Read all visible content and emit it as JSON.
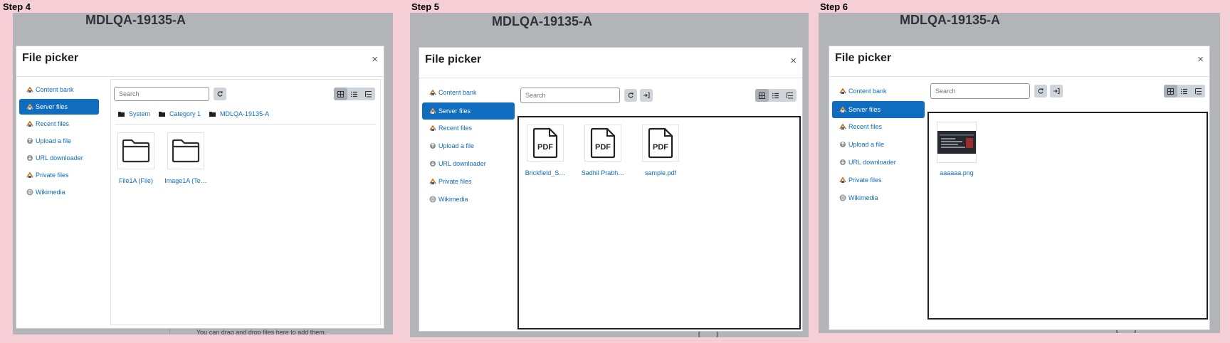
{
  "panels": [
    {
      "step": "Step 4",
      "course": "MDLQA-19135-A",
      "dialog": {
        "title": "File picker",
        "close": "×",
        "repos": [
          {
            "label": "Content bank",
            "icon": "content-bank-icon",
            "active": false
          },
          {
            "label": "Server files",
            "icon": "server-files-icon",
            "active": true
          },
          {
            "label": "Recent files",
            "icon": "recent-files-icon",
            "active": false
          },
          {
            "label": "Upload a file",
            "icon": "upload-icon",
            "active": false
          },
          {
            "label": "URL downloader",
            "icon": "url-downloader-icon",
            "active": false
          },
          {
            "label": "Private files",
            "icon": "private-files-icon",
            "active": false
          },
          {
            "label": "Wikimedia",
            "icon": "wikimedia-icon",
            "active": false
          }
        ],
        "search_placeholder": "Search",
        "breadcrumb": [
          "System",
          "Category 1",
          "MDLQA-19135-A"
        ],
        "files": [
          {
            "name": "File1A (File)",
            "kind": "folder"
          },
          {
            "name": "Image1A (Te…",
            "kind": "folder"
          }
        ]
      },
      "bg_footer": "You can drag and drop files here to add them."
    },
    {
      "step": "Step 5",
      "course": "MDLQA-19135-A",
      "dialog": {
        "title": "File picker",
        "close": "×",
        "repos": [
          {
            "label": "Content bank",
            "icon": "content-bank-icon",
            "active": false
          },
          {
            "label": "Server files",
            "icon": "server-files-icon",
            "active": true
          },
          {
            "label": "Recent files",
            "icon": "recent-files-icon",
            "active": false
          },
          {
            "label": "Upload a file",
            "icon": "upload-icon",
            "active": false
          },
          {
            "label": "URL downloader",
            "icon": "url-downloader-icon",
            "active": false
          },
          {
            "label": "Private files",
            "icon": "private-files-icon",
            "active": false
          },
          {
            "label": "Wikimedia",
            "icon": "wikimedia-icon",
            "active": false
          }
        ],
        "search_placeholder": "Search",
        "files": [
          {
            "name": "Brickfield_S…",
            "kind": "pdf",
            "badge": "PDF"
          },
          {
            "name": "Sadhil Prabh…",
            "kind": "pdf",
            "badge": "PDF"
          },
          {
            "name": "sample.pdf",
            "kind": "pdf",
            "badge": "PDF"
          }
        ]
      }
    },
    {
      "step": "Step 6",
      "course": "MDLQA-19135-A",
      "dialog": {
        "title": "File picker",
        "close": "×",
        "repos": [
          {
            "label": "Content bank",
            "icon": "content-bank-icon",
            "active": false
          },
          {
            "label": "Server files",
            "icon": "server-files-icon",
            "active": true
          },
          {
            "label": "Recent files",
            "icon": "recent-files-icon",
            "active": false
          },
          {
            "label": "Upload a file",
            "icon": "upload-icon",
            "active": false
          },
          {
            "label": "URL downloader",
            "icon": "url-downloader-icon",
            "active": false
          },
          {
            "label": "Private files",
            "icon": "private-files-icon",
            "active": false
          },
          {
            "label": "Wikimedia",
            "icon": "wikimedia-icon",
            "active": false
          }
        ],
        "search_placeholder": "Search",
        "files": [
          {
            "name": "aaaaaa.png",
            "kind": "image"
          }
        ]
      }
    }
  ],
  "colors": {
    "page_bg": "#f6cfd6",
    "overlay": "#b3b4b7",
    "accent": "#0f6cbf"
  }
}
